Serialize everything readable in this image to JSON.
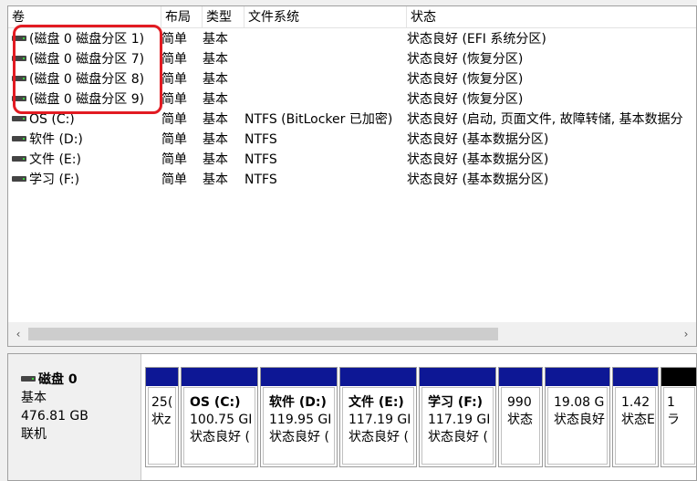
{
  "columns": [
    "卷",
    "布局",
    "类型",
    "文件系统",
    "状态"
  ],
  "volumes": [
    {
      "name": "(磁盘 0 磁盘分区 1)",
      "layout": "简单",
      "type": "基本",
      "fs": "",
      "status": "状态良好 (EFI 系统分区)"
    },
    {
      "name": "(磁盘 0 磁盘分区 7)",
      "layout": "简单",
      "type": "基本",
      "fs": "",
      "status": "状态良好 (恢复分区)"
    },
    {
      "name": "(磁盘 0 磁盘分区 8)",
      "layout": "简单",
      "type": "基本",
      "fs": "",
      "status": "状态良好 (恢复分区)"
    },
    {
      "name": "(磁盘 0 磁盘分区 9)",
      "layout": "简单",
      "type": "基本",
      "fs": "",
      "status": "状态良好 (恢复分区)"
    },
    {
      "name": "OS (C:)",
      "layout": "简单",
      "type": "基本",
      "fs": "NTFS (BitLocker 已加密)",
      "status": "状态良好 (启动, 页面文件, 故障转储, 基本数据分"
    },
    {
      "name": "软件 (D:)",
      "layout": "简单",
      "type": "基本",
      "fs": "NTFS",
      "status": "状态良好 (基本数据分区)"
    },
    {
      "name": "文件 (E:)",
      "layout": "简单",
      "type": "基本",
      "fs": "NTFS",
      "status": "状态良好 (基本数据分区)"
    },
    {
      "name": "学习 (F:)",
      "layout": "简单",
      "type": "基本",
      "fs": "NTFS",
      "status": "状态良好 (基本数据分区)"
    }
  ],
  "scroll": {
    "left_arrow": "‹",
    "right_arrow": "›"
  },
  "disk": {
    "name": "磁盘 0",
    "type": "基本",
    "size": "476.81 GB",
    "state": "联机"
  },
  "partitions": [
    {
      "name": "",
      "size": "25(",
      "status": "状z"
    },
    {
      "name": "OS  (C:)",
      "size": "100.75 GI",
      "status": "状态良好 ("
    },
    {
      "name": "软件  (D:)",
      "size": "119.95 GI",
      "status": "状态良好 ("
    },
    {
      "name": "文件  (E:)",
      "size": "117.19 GI",
      "status": "状态良好 ("
    },
    {
      "name": "学习  (F:)",
      "size": "117.19 GI",
      "status": "状态良好 ("
    },
    {
      "name": "",
      "size": "990",
      "status": "状态"
    },
    {
      "name": "",
      "size": "19.08 G",
      "status": "状态良好"
    },
    {
      "name": "",
      "size": "1.42",
      "status": "状态E"
    },
    {
      "name": "",
      "size": "1",
      "status": "ラ"
    }
  ],
  "colors": {
    "primary_bar": "#0d1795",
    "highlight": "#e21b22"
  }
}
